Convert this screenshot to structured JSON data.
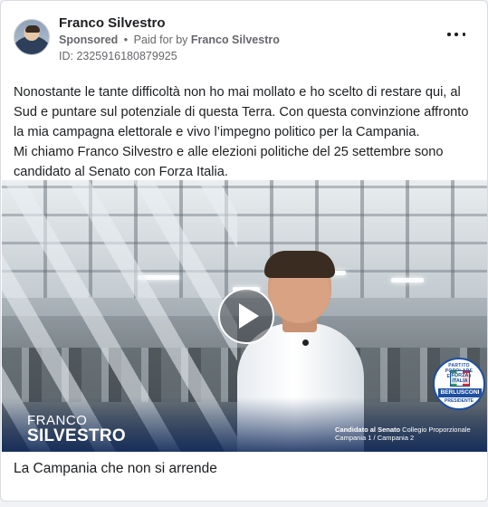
{
  "post": {
    "page_name": "Franco Silvestro",
    "sponsored_label": "Sponsored",
    "separator": "•",
    "paid_for_label": "Paid for by",
    "payer": "Franco Silvestro",
    "ad_id": "ID: 2325916180879925",
    "more_icon": "more-horizontal-icon",
    "body": "Nonostante le tante difficoltà non ho mai mollato e ho scelto di restare qui, al Sud e puntare sul potenziale di questa Terra. Con questa convinzione affronto la mia campagna elettorale e vivo l’impegno politico per la Campania.\nMi chiamo Franco Silvestro e alle elezioni politiche del 25 settembre sono candidato al Senato con Forza Italia.",
    "caption": "La Campania che non si arrende"
  },
  "video": {
    "name_first": "FRANCO",
    "name_last": "SILVESTRO",
    "candidacy_bold": "Candidato al Senato",
    "candidacy_rest": " Collegio Proporzionale",
    "candidacy_line2": "Campania 1 / Campania 2",
    "play_icon": "play-icon",
    "logo": {
      "ring": "PARTITO POPOLARE EUROPEO",
      "party": "FORZA ITALIA",
      "leader": "BERLUSCONI",
      "role": "PRESIDENTE"
    }
  },
  "colors": {
    "text": "#1c1e21",
    "secondary_text": "#65676b",
    "brand_blue": "#1d4fa0"
  }
}
